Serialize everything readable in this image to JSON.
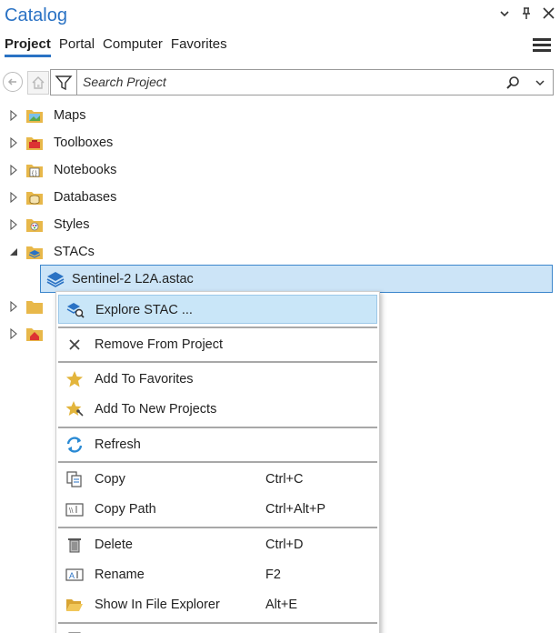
{
  "pane": {
    "title": "Catalog",
    "controls": [
      "chevron-down-icon",
      "pin-icon",
      "close-icon"
    ]
  },
  "tabs": [
    {
      "label": "Project",
      "active": true
    },
    {
      "label": "Portal",
      "active": false
    },
    {
      "label": "Computer",
      "active": false
    },
    {
      "label": "Favorites",
      "active": false
    }
  ],
  "search": {
    "placeholder": "Search Project",
    "value": ""
  },
  "tree": {
    "items": [
      {
        "label": "Maps",
        "icon": "maps-folder-icon",
        "expanded": false
      },
      {
        "label": "Toolboxes",
        "icon": "toolboxes-folder-icon",
        "expanded": false
      },
      {
        "label": "Notebooks",
        "icon": "notebooks-folder-icon",
        "expanded": false
      },
      {
        "label": "Databases",
        "icon": "databases-folder-icon",
        "expanded": false
      },
      {
        "label": "Styles",
        "icon": "styles-folder-icon",
        "expanded": false
      },
      {
        "label": "STACs",
        "icon": "stacs-folder-icon",
        "expanded": true
      }
    ],
    "selected": {
      "label": "Sentinel-2 L2A.astac",
      "icon": "stac-layer-icon"
    }
  },
  "context_menu": {
    "items": [
      {
        "label": "Explore STAC ...",
        "shortcut": "",
        "icon": "explore-stac-icon",
        "hover": true
      },
      {
        "label": "Remove From Project",
        "shortcut": "",
        "icon": "remove-x-icon"
      },
      {
        "label": "Add To Favorites",
        "shortcut": "",
        "icon": "star-icon"
      },
      {
        "label": "Add To New Projects",
        "shortcut": "",
        "icon": "star-pin-icon"
      },
      {
        "label": "Refresh",
        "shortcut": "",
        "icon": "refresh-icon"
      },
      {
        "label": "Copy",
        "shortcut": "Ctrl+C",
        "icon": "copy-icon"
      },
      {
        "label": "Copy Path",
        "shortcut": "Ctrl+Alt+P",
        "icon": "copy-path-icon"
      },
      {
        "label": "Delete",
        "shortcut": "Ctrl+D",
        "icon": "trash-icon"
      },
      {
        "label": "Rename",
        "shortcut": "F2",
        "icon": "rename-icon"
      },
      {
        "label": "Show In File Explorer",
        "shortcut": "Alt+E",
        "icon": "open-folder-icon"
      }
    ]
  },
  "colors": {
    "accent": "#2a72c4",
    "selection_bg": "#cce4f7",
    "selection_border": "#3c86cc",
    "menu_hover": "#c9e6f8",
    "folder": "#e8b84a"
  }
}
